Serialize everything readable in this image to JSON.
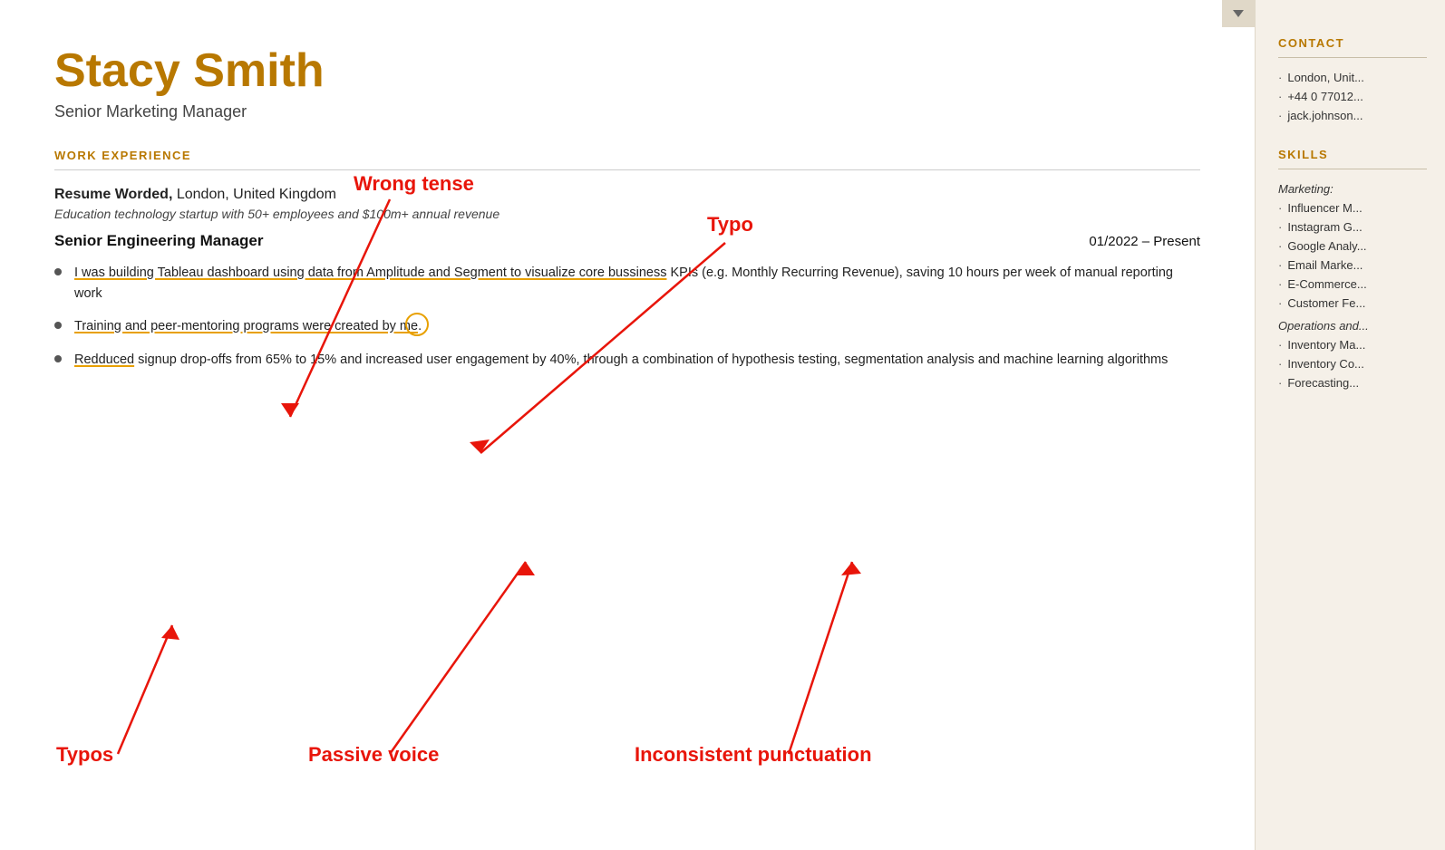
{
  "header": {
    "name": "Stacy Smith",
    "title": "Senior Marketing Manager"
  },
  "sections": {
    "work_experience_label": "WORK EXPERIENCE",
    "company": {
      "name_bold": "Resume Worded,",
      "name_rest": " London, United Kingdom",
      "subtitle": "Education technology startup with 50+ employees and $100m+ annual revenue"
    },
    "job": {
      "title": "Senior Engineering Manager",
      "dates": "01/2022 – Present"
    },
    "bullets": [
      {
        "id": 1,
        "text_pre": "I was building Tableau da",
        "text_underlined": "shboard using data from Amplitude and Segment to visualize core ",
        "text_typo": "bussiness",
        "text_post": " KPIs (e.g. Monthly Recurring Revenue), saving 10 hours per week of manual reporting work"
      },
      {
        "id": 2,
        "text_pre": "Training and peer-mentoring programs were created by m",
        "text_circle": "e",
        "text_post": "."
      },
      {
        "id": 3,
        "text_typo1": "Redduced",
        "text_mid": " signup drop-offs from 65% to 15% and increased user engagement by 40%, through a combination of hypothesis testing, segmentation analysis and machine learning algorithms"
      }
    ]
  },
  "annotations": {
    "wrong_tense": "Wrong tense",
    "typo_top": "Typo",
    "typos_bottom": "Typos",
    "passive_voice": "Passive voice",
    "inconsistent_punctuation": "Inconsistent punctuation"
  },
  "sidebar": {
    "contact_label": "CONTACT",
    "contact_items": [
      "London, Unit...",
      "+44 0 77012...",
      "jack.johnson..."
    ],
    "skills_label": "SKILLS",
    "skills_categories": [
      {
        "name": "Marketing:",
        "items": [
          "Influencer M...",
          "Instagram G...",
          "Google Analy...",
          "Email Marke...",
          "E-Commerce...",
          "Customer Fe..."
        ]
      },
      {
        "name": "Operations and...",
        "items": [
          "Inventory Ma...",
          "Inventory Co...",
          "Forecasting..."
        ]
      }
    ]
  }
}
